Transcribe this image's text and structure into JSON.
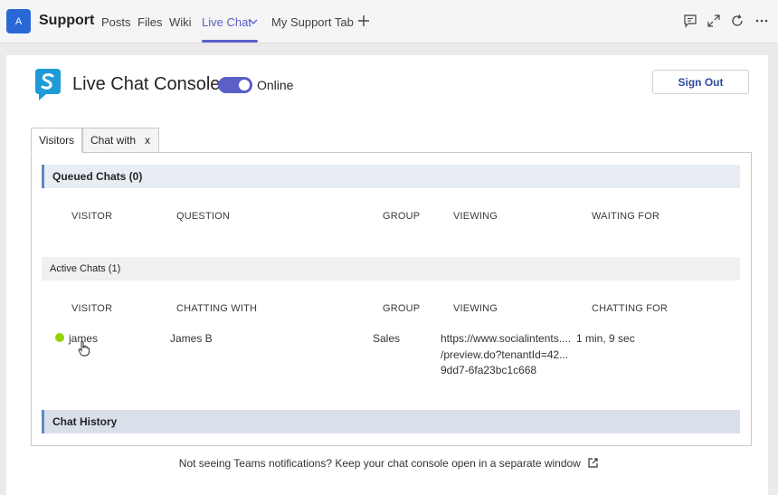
{
  "teams": {
    "app_icon_letter": "A",
    "app_title": "Support",
    "tabs": [
      {
        "label": "Posts"
      },
      {
        "label": "Files"
      },
      {
        "label": "Wiki"
      },
      {
        "label": "Live Chat",
        "active": true
      },
      {
        "label": "My Support Tab"
      }
    ],
    "accent": "#5b5fc7"
  },
  "console": {
    "title": "Live Chat Console",
    "status_label": "Online",
    "status_on": true,
    "sign_out_label": "Sign Out",
    "tabs": [
      {
        "label": "Visitors",
        "active": true
      },
      {
        "label": "Chat with",
        "close": "x"
      }
    ],
    "queued": {
      "header": "Queued Chats (0)",
      "columns": [
        "VISITOR",
        "QUESTION",
        "GROUP",
        "VIEWING",
        "WAITING FOR"
      ]
    },
    "active": {
      "header": "Active Chats (1)",
      "columns": [
        "VISITOR",
        "CHATTING WITH",
        "GROUP",
        "VIEWING",
        "CHATTING FOR"
      ],
      "rows": [
        {
          "visitor": "james",
          "chatting_with": "James B",
          "group": "Sales",
          "viewing_lines": [
            "https://www.socialintents....",
            "/preview.do?tenantId=42...",
            "9dd7-6fa23bc1c668"
          ],
          "chatting_for": "1 min, 9 sec",
          "status_color": "#92d400"
        }
      ]
    },
    "history_header": "Chat History"
  },
  "footer": {
    "note": "Not seeing Teams notifications? Keep your chat console open in a separate window"
  }
}
